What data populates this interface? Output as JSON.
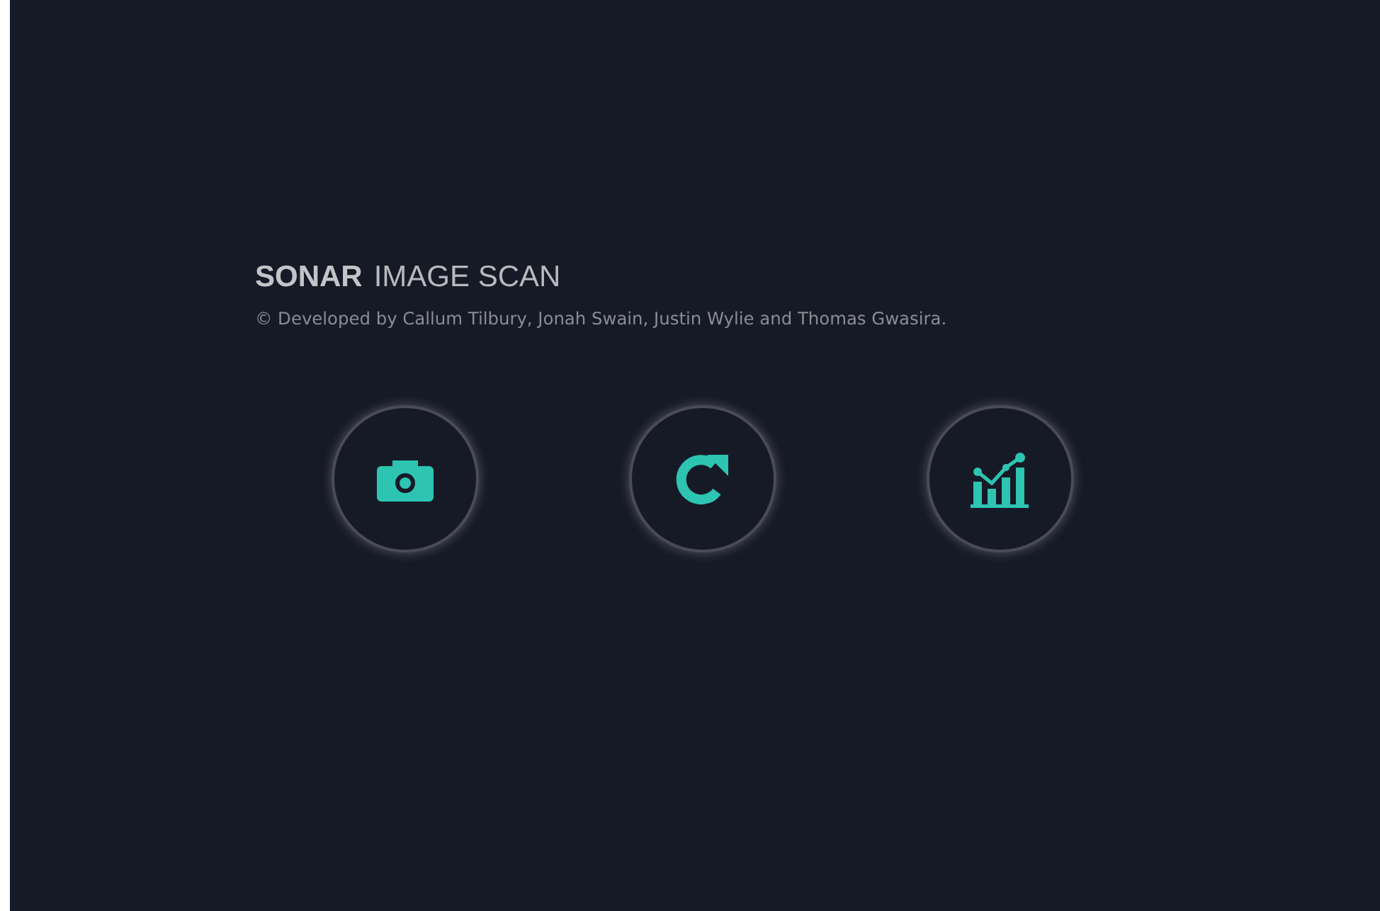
{
  "title": {
    "brand": "SONAR",
    "subtitle": "IMAGE SCAN"
  },
  "credits": "© Developed by Callum Tilbury, Jonah Swain, Justin Wylie and Thomas Gwasira.",
  "buttons": [
    {
      "kind": "camera"
    },
    {
      "kind": "refresh"
    },
    {
      "kind": "chart"
    }
  ]
}
